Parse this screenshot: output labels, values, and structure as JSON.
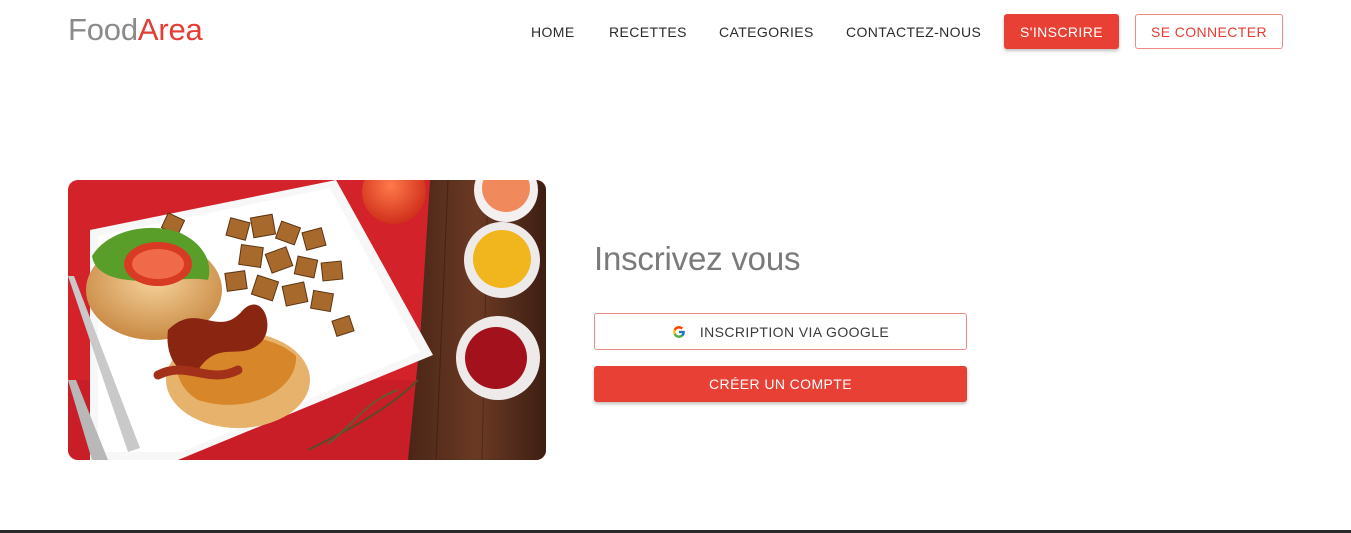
{
  "brand": {
    "part1": "Food",
    "part2": "Area",
    "color_primary": "#e53c33",
    "color_secondary": "#8a8a8a"
  },
  "nav": {
    "links": [
      "HOME",
      "RECETTES",
      "CATEGORIES",
      "CONTACTEZ-NOUS"
    ],
    "signup": "S'INSCRIRE",
    "login": "SE CONNECTER"
  },
  "signup_panel": {
    "title": "Inscrivez vous",
    "google_label": "INSCRIPTION VIA GOOGLE",
    "google_icon": "google-icon",
    "create_label": "CRÉER UN COMPTE"
  },
  "colors": {
    "accent": "#e94035",
    "text": "#2b2b2b"
  }
}
